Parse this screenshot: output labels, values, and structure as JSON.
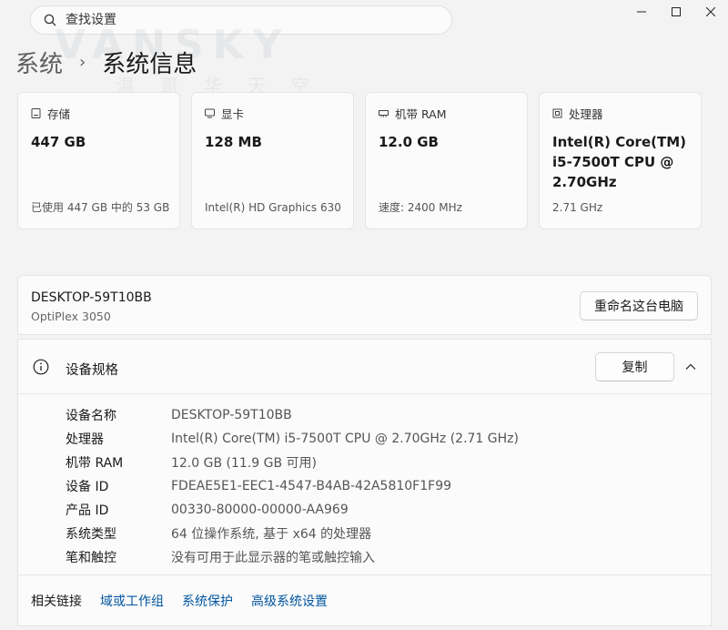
{
  "search": {
    "placeholder": "查找设置"
  },
  "breadcrumb": {
    "parent": "系统",
    "separator": "›",
    "current": "系统信息"
  },
  "watermark": {
    "line1": "VANSKY",
    "line2": "温哥华天空"
  },
  "cards": [
    {
      "icon": "storage-icon",
      "title": "存储",
      "value": "447 GB",
      "sub": "已使用 447 GB 中的 53 GB"
    },
    {
      "icon": "display-card-icon",
      "title": "显卡",
      "value": "128 MB",
      "sub": "Intel(R) HD Graphics 630"
    },
    {
      "icon": "ram-icon",
      "title": "机带 RAM",
      "value": "12.0 GB",
      "sub": "速度: 2400 MHz"
    },
    {
      "icon": "processor-icon",
      "title": "处理器",
      "value": "Intel(R) Core(TM) i5-7500T CPU @ 2.70GHz",
      "sub": "2.71 GHz"
    }
  ],
  "device": {
    "name": "DESKTOP-59T10BB",
    "model": "OptiPlex 3050",
    "rename_label": "重命名这台电脑"
  },
  "specs": {
    "title": "设备规格",
    "copy_label": "复制",
    "rows": [
      {
        "label": "设备名称",
        "value": "DESKTOP-59T10BB"
      },
      {
        "label": "处理器",
        "value": "Intel(R) Core(TM) i5-7500T CPU @ 2.70GHz (2.71 GHz)"
      },
      {
        "label": "机带 RAM",
        "value": "12.0 GB (11.9 GB 可用)"
      },
      {
        "label": "设备 ID",
        "value": "FDEAE5E1-EEC1-4547-B4AB-42A5810F1F99"
      },
      {
        "label": "产品 ID",
        "value": "00330-80000-00000-AA969"
      },
      {
        "label": "系统类型",
        "value": "64 位操作系统, 基于 x64 的处理器"
      },
      {
        "label": "笔和触控",
        "value": "没有可用于此显示器的笔或触控输入"
      }
    ]
  },
  "related": {
    "label": "相关链接",
    "links": [
      "域或工作组",
      "系统保护",
      "高级系统设置"
    ]
  },
  "colors": {
    "link": "#00559f",
    "background": "#f3f3f3",
    "panel": "#fbfbfb"
  }
}
